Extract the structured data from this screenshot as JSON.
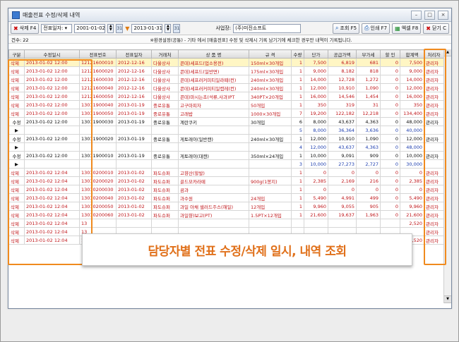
{
  "window": {
    "title": "매출전표 수정/삭제 내역"
  },
  "toolbar": {
    "delete_label": "삭제 F4",
    "date_type": "전표일자:",
    "date_from": "2001-01-02",
    "date_to": "2013-01-31",
    "business_label": "사업장:",
    "business_value": "(주)미진소프트",
    "search_label": "조회 F5",
    "print_label": "인쇄 F7",
    "excel_label": "엑셀 F8",
    "close_label": "닫기",
    "close_key": "C"
  },
  "info": {
    "count": "건수: 22",
    "notice": "※환경설정(공통) - 기타 에서 [매출전표] 수정 및 삭제시 기록 남기기에 체크한 경우만 내역이 기록됩니다."
  },
  "columns": [
    "구분",
    "수정일시",
    "전표번호",
    "전표일자",
    "거래처",
    "상 품 명",
    "규 격",
    "수량",
    "단가",
    "공급가액",
    "부가세",
    "할 인",
    "합계액",
    "처리자"
  ],
  "rows": [
    {
      "c": [
        "삭제",
        "2013-01-02 12:00",
        "12121600010",
        "2012-12-16",
        "다울상사",
        "콘데)세프드(업소용전)",
        "150ml×30개입",
        "1",
        "7,500",
        "6,819",
        "681",
        "0",
        "7,500",
        "관리자"
      ],
      "sel": true
    },
    {
      "c": [
        "삭제",
        "2013-01-02 12:00",
        "12121600020",
        "2012-12-16",
        "다울상사",
        "콘데)세프드(일반면)",
        "175ml×30개입",
        "1",
        "9,000",
        "8,182",
        "818",
        "0",
        "9,000",
        "관리자"
      ]
    },
    {
      "c": [
        "삭제",
        "2013-01-02 12:00",
        "12121600030",
        "2012-12-16",
        "다울상사",
        "콘데)세프러커피티일라떼(컨)",
        "240ml×30개입",
        "1",
        "14,000",
        "12,728",
        "1,272",
        "0",
        "14,000",
        "관리자"
      ]
    },
    {
      "c": [
        "삭제",
        "2013-01-02 12:00",
        "12121600040",
        "2012-12-16",
        "다울상사",
        "콘데)세프러커피티일캡레(컨)",
        "240ml×30개입",
        "1",
        "12,000",
        "10,910",
        "1,090",
        "0",
        "12,000",
        "관리자"
      ]
    },
    {
      "c": [
        "삭제",
        "2013-01-02 12:00",
        "12121600050",
        "2012-12-16",
        "다울상사",
        "콘데)마시는초(석류,사과)PT",
        "340PT×20개입",
        "1",
        "16,000",
        "14,546",
        "1,454",
        "0",
        "16,000",
        "관리자"
      ]
    },
    {
      "c": [
        "삭제",
        "2013-01-02 12:00",
        "13011900040",
        "2013-01-19",
        "중로유통",
        "고구마피자",
        "50개입",
        "1",
        "350",
        "319",
        "31",
        "0",
        "350",
        "관리자"
      ]
    },
    {
      "c": [
        "삭제",
        "2013-01-02 12:00",
        "13011900050",
        "2013-01-19",
        "중로유통",
        "고래밥",
        "1000×30개입",
        "7",
        "19,200",
        "122,182",
        "12,218",
        "0",
        "134,400",
        "관리자"
      ]
    },
    {
      "c": [
        "수정",
        "2013-01-02 12:00",
        "13011900030",
        "2013-01-19",
        "중로유통",
        "계란쿠키",
        "30개입",
        "6",
        "8,000",
        "43,637",
        "4,363",
        "0",
        "48,000",
        "관리자"
      ],
      "edit": true,
      "spanTop": true
    },
    {
      "c": [
        "▶",
        "",
        "",
        "",
        "",
        "",
        "",
        "5",
        "8,000",
        "36,364",
        "3,636",
        "0",
        "40,000",
        ""
      ],
      "edit": true,
      "cont": true
    },
    {
      "c": [
        "수정",
        "2013-01-02 12:00",
        "13011900020",
        "2013-01-19",
        "중로유통",
        "게토레이(일반캔)",
        "240ml×30개입",
        "1",
        "12,000",
        "10,910",
        "1,090",
        "0",
        "12,000",
        "관리자"
      ],
      "edit": true,
      "spanTop": true
    },
    {
      "c": [
        "▶",
        "",
        "",
        "",
        "",
        "",
        "",
        "4",
        "12,000",
        "43,637",
        "4,363",
        "0",
        "48,000",
        ""
      ],
      "edit": true,
      "cont": true
    },
    {
      "c": [
        "수정",
        "2013-01-02 12:00",
        "13011900010",
        "2013-01-19",
        "중로유통",
        "게토레이(대캔)",
        "350ml×24개입",
        "1",
        "10,000",
        "9,091",
        "909",
        "0",
        "10,000",
        "관리자"
      ],
      "edit": true,
      "spanTop": true
    },
    {
      "c": [
        "▶",
        "",
        "",
        "",
        "",
        "",
        "",
        "3",
        "10,000",
        "27,273",
        "2,727",
        "0",
        "30,000",
        ""
      ],
      "edit": true,
      "cont": true
    },
    {
      "c": [
        "삭제",
        "2013-01-02 12:04",
        "13010200010",
        "2013-01-02",
        "파도슈퍼",
        "고향산(할발)",
        "",
        "1",
        "0",
        "0",
        "0",
        "0",
        "0",
        "관리자"
      ]
    },
    {
      "c": [
        "삭제",
        "2013-01-02 12:04",
        "13010200020",
        "2013-01-02",
        "파도슈퍼",
        "골드모카라떼",
        "900g(1봉지)",
        "1",
        "2,385",
        "2,169",
        "216",
        "0",
        "2,385",
        "관리자"
      ]
    },
    {
      "c": [
        "삭제",
        "2013-01-02 12:04",
        "13010200030",
        "2013-01-02",
        "파도슈퍼",
        "곰과",
        "",
        "1",
        "0",
        "0",
        "0",
        "0",
        "0",
        "관리자"
      ]
    },
    {
      "c": [
        "삭제",
        "2013-01-02 12:04",
        "13010200040",
        "2013-01-02",
        "파도슈퍼",
        "과수원",
        "24개입",
        "1",
        "5,490",
        "4,991",
        "499",
        "0",
        "5,490",
        "관리자"
      ]
    },
    {
      "c": [
        "삭제",
        "2013-01-02 12:04",
        "13010200050",
        "2013-01-02",
        "파도슈퍼",
        "과일 아채 샐러드주스(해일)",
        "12개입",
        "1",
        "9,960",
        "9,055",
        "905",
        "0",
        "9,960",
        "관리자"
      ]
    },
    {
      "c": [
        "삭제",
        "2013-01-02 12:04",
        "13010200060",
        "2013-01-02",
        "파도슈퍼",
        "과일향)보고(PT)",
        "1.5PT×12개입",
        "1",
        "21,600",
        "19,637",
        "1,963",
        "0",
        "21,600",
        "관리자"
      ]
    },
    {
      "c": [
        "삭제",
        "2013-01-02 12:04",
        "13",
        "",
        "",
        "",
        "",
        "",
        "",
        "",
        "",
        "",
        "2,520",
        "관리자"
      ]
    },
    {
      "c": [
        "삭제",
        "2013-01-02 12:04",
        "13",
        "",
        "",
        "",
        "",
        "",
        "",
        "",
        "",
        "",
        "",
        "관리자"
      ]
    },
    {
      "c": [
        "삭제",
        "2013-01-02 12:04",
        "13",
        "",
        "",
        "",
        "",
        "",
        "",
        "",
        "",
        "",
        "2,520",
        "관리자"
      ]
    }
  ],
  "callout": {
    "text": "담당자별 전표 수정/삭제 일시, 내역 조회"
  },
  "colors": {
    "highlight": "#f08a1e",
    "deleted_text": "#c0171b",
    "selected_row": "#fff6c4"
  }
}
